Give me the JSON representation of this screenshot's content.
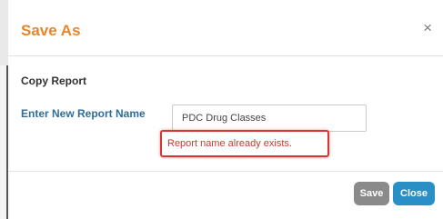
{
  "dialog": {
    "title": "Save As",
    "close_glyph": "×"
  },
  "form": {
    "section_title": "Copy Report",
    "field_label": "Enter New Report Name",
    "input_value": "PDC Drug Classes",
    "error_message": "Report name already exists."
  },
  "buttons": {
    "save_label": "Save",
    "close_label": "Close"
  },
  "colors": {
    "title": "#e8852b",
    "label": "#2f6d9c",
    "error": "#d23434",
    "save_button": "#8a8a8a",
    "close_button": "#2a8fc4"
  }
}
